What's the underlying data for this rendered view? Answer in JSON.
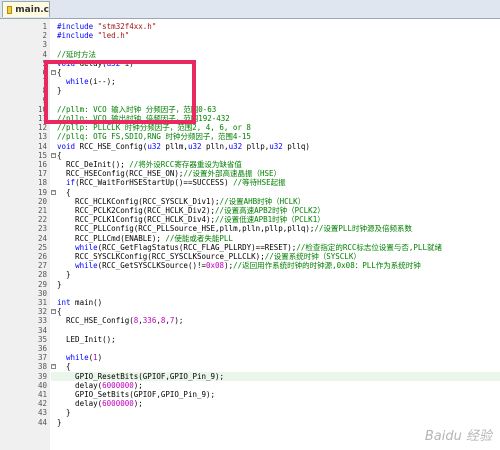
{
  "tab": {
    "label": "main.c"
  },
  "lines": [
    {
      "n": "1",
      "t": "#include \"stm32f4xx.h\""
    },
    {
      "n": "2",
      "t": "#include \"led.h\""
    },
    {
      "n": "3",
      "t": ""
    },
    {
      "n": "4",
      "t": "//延时方法"
    },
    {
      "n": "5",
      "t": "void delay(u32 i)"
    },
    {
      "n": "6",
      "t": "{"
    },
    {
      "n": "7",
      "t": "  while(i--);"
    },
    {
      "n": "8",
      "t": "}"
    },
    {
      "n": "9",
      "t": ""
    },
    {
      "n": "10",
      "t": "//pllm: VCO 输入时钟 分频因子，范围0-63"
    },
    {
      "n": "11",
      "t": "//plln: VCO 输出时钟 倍频因子，范围192-432"
    },
    {
      "n": "12",
      "t": "//pllp: PLLCLK 时钟分频因子，范围2, 4, 6, or 8"
    },
    {
      "n": "13",
      "t": "//pllq: OTG FS,SDIO,RNG 时钟分频因子，范围4-15"
    },
    {
      "n": "14",
      "t": "void RCC_HSE_Config(u32 pllm,u32 plln,u32 pllp,u32 pllq)"
    },
    {
      "n": "15",
      "t": "{"
    },
    {
      "n": "16",
      "t": "  RCC_DeInit(); //将外设RCC寄存器重设为缺省值"
    },
    {
      "n": "17",
      "t": "  RCC_HSEConfig(RCC_HSE_ON);//设置外部高速晶振（HSE）"
    },
    {
      "n": "18",
      "t": "  if(RCC_WaitForHSEStartUp()==SUCCESS) //等待HSE起振"
    },
    {
      "n": "19",
      "t": "  {"
    },
    {
      "n": "20",
      "t": "    RCC_HCLKConfig(RCC_SYSCLK_Div1);//设置AHB时钟（HCLK）"
    },
    {
      "n": "21",
      "t": "    RCC_PCLK2Config(RCC_HCLK_Div2);//设置高速APB2时钟（PCLK2）"
    },
    {
      "n": "22",
      "t": "    RCC_PCLK1Config(RCC_HCLK_Div4);//设置低速APB1时钟（PCLK1）"
    },
    {
      "n": "23",
      "t": "    RCC_PLLConfig(RCC_PLLSource_HSE,pllm,plln,pllp,pllq);//设置PLL时钟源及倍频系数"
    },
    {
      "n": "24",
      "t": "    RCC_PLLCmd(ENABLE); //使能或者失能PLL"
    },
    {
      "n": "25",
      "t": "    while(RCC_GetFlagStatus(RCC_FLAG_PLLRDY)==RESET);//检查指定的RCC标志位设置与否,PLL就绪"
    },
    {
      "n": "26",
      "t": "    RCC_SYSCLKConfig(RCC_SYSCLKSource_PLLCLK);//设置系统时钟（SYSCLK）"
    },
    {
      "n": "27",
      "t": "    while(RCC_GetSYSCLKSource()!=0x08);//返回用作系统时钟的时钟源,0x08：PLL作为系统时钟"
    },
    {
      "n": "28",
      "t": "  }"
    },
    {
      "n": "29",
      "t": "}"
    },
    {
      "n": "30",
      "t": ""
    },
    {
      "n": "31",
      "t": "int main()"
    },
    {
      "n": "32",
      "t": "{"
    },
    {
      "n": "33",
      "t": "  RCC_HSE_Config(8,336,8,7);"
    },
    {
      "n": "34",
      "t": ""
    },
    {
      "n": "35",
      "t": "  LED_Init();"
    },
    {
      "n": "36",
      "t": ""
    },
    {
      "n": "37",
      "t": "  while(1)"
    },
    {
      "n": "38",
      "t": "  {"
    },
    {
      "n": "39",
      "t": "    GPIO_ResetBits(GPIOF,GPIO_Pin_9);"
    },
    {
      "n": "40",
      "t": "    delay(6000000);"
    },
    {
      "n": "41",
      "t": "    GPIO_SetBits(GPIOF,GPIO_Pin_9);"
    },
    {
      "n": "42",
      "t": "    delay(6000000);"
    },
    {
      "n": "43",
      "t": "  }"
    },
    {
      "n": "44",
      "t": "}"
    }
  ],
  "colors": {
    "keyword": "#0000ff",
    "comment": "#008000",
    "string": "#a31515",
    "number": "#c000c0",
    "highlight_box": "#e8285f"
  },
  "watermark": "Baidu 经验"
}
